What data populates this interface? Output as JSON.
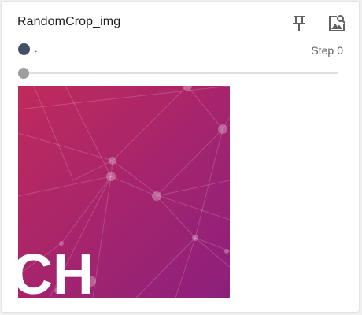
{
  "card": {
    "title": "RandomCrop_img",
    "run_label": ".",
    "step_label": "Step",
    "step_value": "0",
    "run_color": "#425066"
  },
  "toolbar": {
    "pin_icon": "pin-icon",
    "expand_icon": "image-search-icon"
  },
  "slider": {
    "value": 0
  },
  "image": {
    "overlay_text": "CH",
    "gradient_start": "#c02a5b",
    "gradient_end": "#8c1f7d"
  }
}
